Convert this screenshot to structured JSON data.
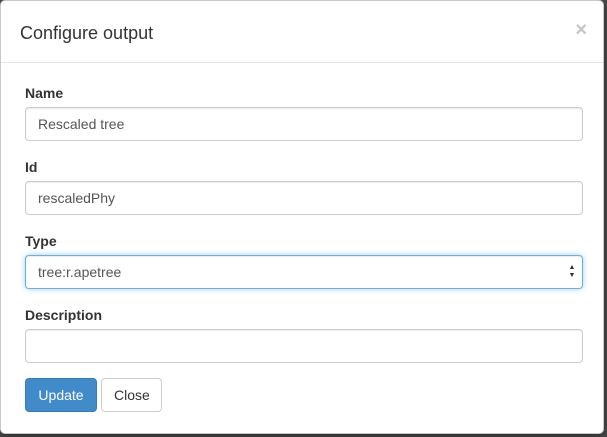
{
  "modal": {
    "title": "Configure output",
    "close_symbol": "×"
  },
  "fields": {
    "name": {
      "label": "Name",
      "value": "Rescaled tree"
    },
    "id": {
      "label": "Id",
      "value": "rescaledPhy"
    },
    "type": {
      "label": "Type",
      "value": "tree:r.apetree"
    },
    "description": {
      "label": "Description",
      "value": ""
    }
  },
  "buttons": {
    "update_label": "Update",
    "close_label": "Close"
  },
  "colors": {
    "primary": "#428bca",
    "focus_border": "#66afe9"
  },
  "icons": {
    "close": "close-icon",
    "select_arrows": "updown-arrows-icon"
  }
}
